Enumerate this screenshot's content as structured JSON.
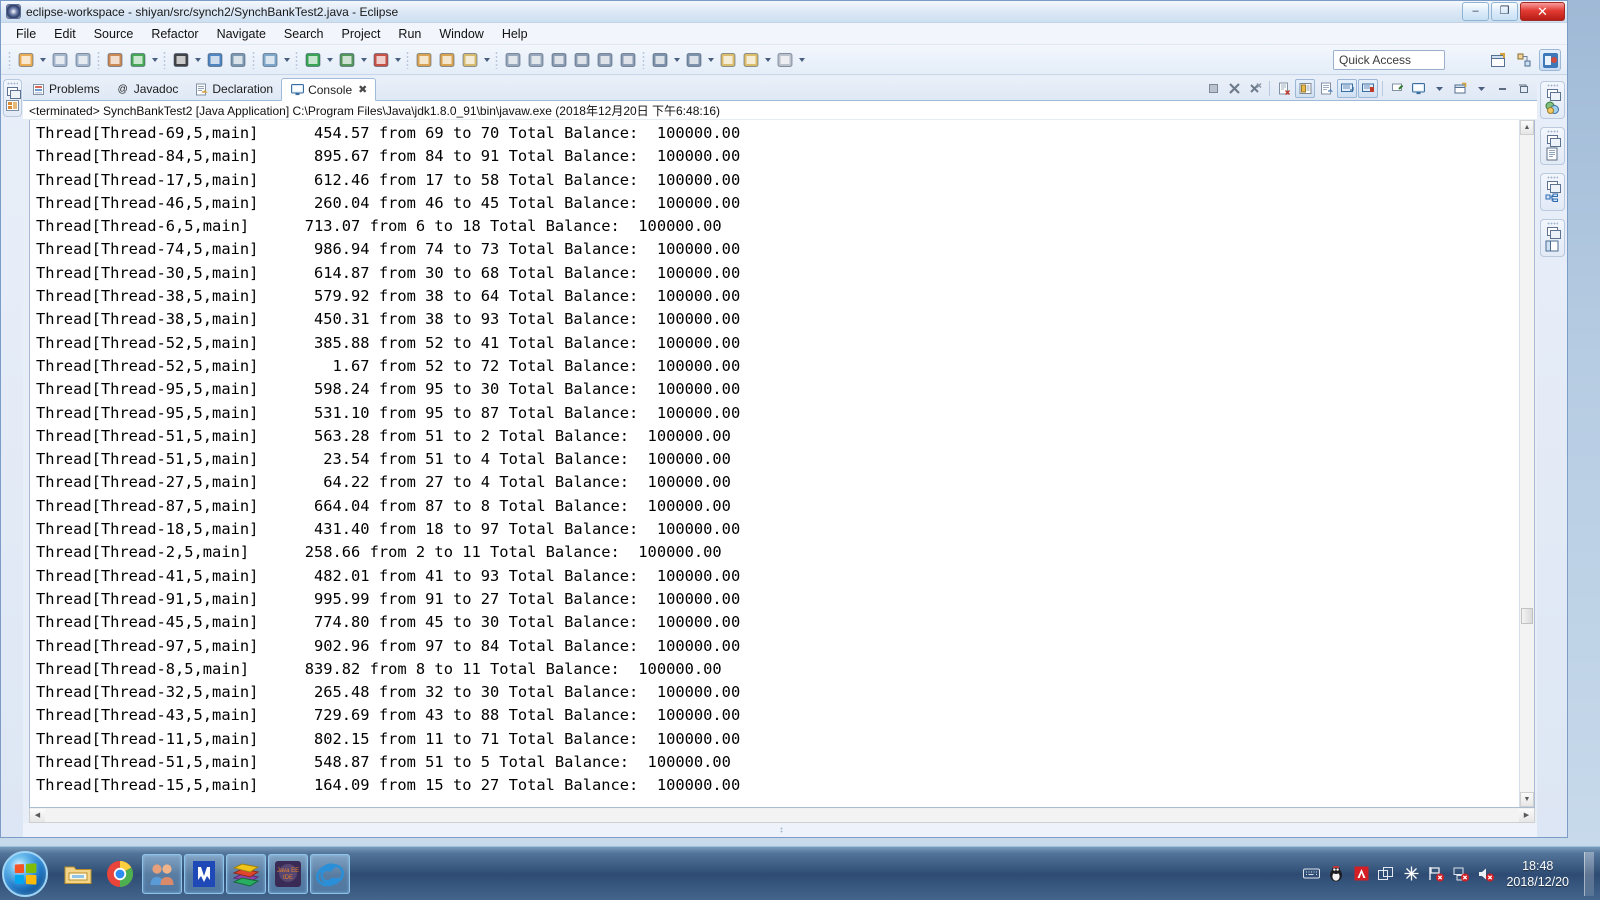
{
  "window": {
    "title": "eclipse-workspace - shiyan/src/synch2/SynchBankTest2.java - Eclipse",
    "app_icon": "eclipse-icon",
    "minimize_label": "–",
    "maximize_label": "❐",
    "close_label": "✕"
  },
  "menubar": {
    "items": [
      {
        "label": "File"
      },
      {
        "label": "Edit"
      },
      {
        "label": "Source"
      },
      {
        "label": "Refactor"
      },
      {
        "label": "Navigate"
      },
      {
        "label": "Search"
      },
      {
        "label": "Project"
      },
      {
        "label": "Run"
      },
      {
        "label": "Window"
      },
      {
        "label": "Help"
      }
    ]
  },
  "toolbar": {
    "quick_access_placeholder": "Quick Access",
    "quick_access_value": "",
    "items": [
      {
        "name": "new-wizard-icon",
        "glyph": "◰",
        "color": "#e8a33d",
        "arrow": true
      },
      {
        "name": "save-icon",
        "glyph": "▤",
        "color": "#9bb0c6",
        "arrow": false
      },
      {
        "name": "save-all-icon",
        "glyph": "▥",
        "color": "#9bb0c6",
        "arrow": false
      },
      {
        "name": "new-java-package-icon",
        "glyph": "⌗",
        "color": "#c77b3c",
        "arrow": false
      },
      {
        "name": "refresh-icon",
        "glyph": "⟳",
        "color": "#2f9e41",
        "arrow": true
      },
      {
        "name": "open-type-icon",
        "glyph": "●",
        "color": "#2b2b2b",
        "arrow": true
      },
      {
        "name": "open-console-icon",
        "glyph": "▣",
        "color": "#3a76b8",
        "arrow": false
      },
      {
        "name": "skip-breakpoints-icon",
        "glyph": "⊘",
        "color": "#6e8da8",
        "arrow": false
      },
      {
        "name": "debug-icon",
        "glyph": "✴",
        "color": "#6f9dc4",
        "arrow": true
      },
      {
        "name": "run-icon",
        "glyph": "▶",
        "color": "#1f9b3d",
        "arrow": true
      },
      {
        "name": "coverage-icon",
        "glyph": "◕",
        "color": "#3f8b46",
        "arrow": true
      },
      {
        "name": "run-external-tools-icon",
        "glyph": "◔",
        "color": "#c23b2e",
        "arrow": true
      },
      {
        "name": "new-java-project-icon",
        "glyph": "◱",
        "color": "#d79a3a",
        "arrow": false
      },
      {
        "name": "new-package-folder-icon",
        "glyph": "◲",
        "color": "#d79a3a",
        "arrow": false
      },
      {
        "name": "search-icon",
        "glyph": "✒",
        "color": "#d4b45c",
        "arrow": true
      },
      {
        "name": "next-annotation-icon",
        "glyph": "↑",
        "color": "#8d9eb4",
        "arrow": false
      },
      {
        "name": "previous-annotation-icon",
        "glyph": "↓",
        "color": "#8d9eb4",
        "arrow": false
      },
      {
        "name": "last-edit-location-icon",
        "glyph": "✎",
        "color": "#7e91a8",
        "arrow": false
      },
      {
        "name": "toggle-mark-occurrences-icon",
        "glyph": "☰",
        "color": "#7e91a8",
        "arrow": false
      },
      {
        "name": "show-whitespace-icon",
        "glyph": "▧",
        "color": "#7e91a8",
        "arrow": false
      },
      {
        "name": "paragraph-mark-icon",
        "glyph": "¶",
        "color": "#7e91a8",
        "arrow": false
      },
      {
        "name": "next-edit-position-icon",
        "glyph": "⤓",
        "color": "#6f86a0",
        "arrow": true
      },
      {
        "name": "previous-edit-position-icon",
        "glyph": "⤒",
        "color": "#6f86a0",
        "arrow": true
      },
      {
        "name": "back-history-icon",
        "glyph": "⇦",
        "color": "#d9b659",
        "arrow": false
      },
      {
        "name": "back-arrow-icon",
        "glyph": "⇦",
        "color": "#d9b659",
        "arrow": true
      },
      {
        "name": "forward-arrow-icon",
        "glyph": "⇨",
        "color": "#b6bcc6",
        "arrow": true
      }
    ],
    "perspective": [
      {
        "name": "open-perspective-icon",
        "glyph": "❐",
        "active": false
      },
      {
        "name": "perspective-java-ee-icon",
        "glyph": "⚙",
        "active": false
      },
      {
        "name": "perspective-java-icon",
        "glyph": "⌨",
        "active": true
      }
    ]
  },
  "left_rail": {
    "buttons": [
      {
        "name": "restore-package-explorer-button",
        "glyph": "▤",
        "color": "#c9792f"
      }
    ]
  },
  "right_rail": {
    "buttons": [
      {
        "name": "restore-outline-button",
        "glyph": "◐",
        "color": "#3e8b4a"
      },
      {
        "name": "restore-task-list-button",
        "glyph": "≡",
        "color": "#5b7fa8"
      },
      {
        "name": "restore-hierarchy-button",
        "glyph": "⊞",
        "color": "#2f6bb0"
      },
      {
        "name": "restore-minimap-button",
        "glyph": "▧",
        "color": "#5b7fa8"
      }
    ]
  },
  "view_tabs": [
    {
      "label": "Problems",
      "icon": "problems-icon",
      "glyph": "⚠",
      "active": false,
      "closable": false
    },
    {
      "label": "Javadoc",
      "icon": "javadoc-icon",
      "glyph": "@",
      "active": false,
      "closable": false
    },
    {
      "label": "Declaration",
      "icon": "declaration-icon",
      "glyph": "▤",
      "active": false,
      "closable": false
    },
    {
      "label": "Console",
      "icon": "console-icon",
      "glyph": "▣",
      "active": true,
      "closable": true,
      "close_glyph": "✖"
    }
  ],
  "view_toolbar": [
    {
      "name": "terminate-icon",
      "glyph": "■",
      "toggled": false
    },
    {
      "name": "remove-launch-icon",
      "glyph": "✖",
      "toggled": false
    },
    {
      "name": "remove-all-terminated-icon",
      "glyph": "✖",
      "toggled": false
    },
    {
      "name": "clear-console-icon",
      "glyph": "▤",
      "toggled": false
    },
    {
      "name": "scroll-lock-icon",
      "glyph": "▥",
      "toggled": true
    },
    {
      "name": "word-wrap-icon",
      "glyph": "▦",
      "toggled": false
    },
    {
      "name": "show-console-on-output-icon",
      "glyph": "▣",
      "toggled": true
    },
    {
      "name": "show-console-on-error-icon",
      "glyph": "▣",
      "toggled": true
    },
    {
      "name": "pin-console-icon",
      "glyph": "⚑",
      "toggled": false
    },
    {
      "name": "display-selected-console-icon",
      "glyph": "▣",
      "toggled": false,
      "arrow": true
    },
    {
      "name": "open-console-icon",
      "glyph": "◰",
      "toggled": false,
      "arrow": true
    },
    {
      "name": "minimize-view-icon",
      "glyph": "—",
      "toggled": false
    },
    {
      "name": "maximize-view-icon",
      "glyph": "❐",
      "toggled": false
    }
  ],
  "console": {
    "launch_line": "<terminated> SynchBankTest2 [Java Application] C:\\Program Files\\Java\\jdk1.8.0_91\\bin\\javaw.exe (2018年12月20日 下午6:48:16)",
    "lines": [
      "Thread[Thread-69,5,main]      454.57 from 69 to 70 Total Balance:  100000.00",
      "Thread[Thread-84,5,main]      895.67 from 84 to 91 Total Balance:  100000.00",
      "Thread[Thread-17,5,main]      612.46 from 17 to 58 Total Balance:  100000.00",
      "Thread[Thread-46,5,main]      260.04 from 46 to 45 Total Balance:  100000.00",
      "Thread[Thread-6,5,main]      713.07 from 6 to 18 Total Balance:  100000.00",
      "Thread[Thread-74,5,main]      986.94 from 74 to 73 Total Balance:  100000.00",
      "Thread[Thread-30,5,main]      614.87 from 30 to 68 Total Balance:  100000.00",
      "Thread[Thread-38,5,main]      579.92 from 38 to 64 Total Balance:  100000.00",
      "Thread[Thread-38,5,main]      450.31 from 38 to 93 Total Balance:  100000.00",
      "Thread[Thread-52,5,main]      385.88 from 52 to 41 Total Balance:  100000.00",
      "Thread[Thread-52,5,main]        1.67 from 52 to 72 Total Balance:  100000.00",
      "Thread[Thread-95,5,main]      598.24 from 95 to 30 Total Balance:  100000.00",
      "Thread[Thread-95,5,main]      531.10 from 95 to 87 Total Balance:  100000.00",
      "Thread[Thread-51,5,main]      563.28 from 51 to 2 Total Balance:  100000.00",
      "Thread[Thread-51,5,main]       23.54 from 51 to 4 Total Balance:  100000.00",
      "Thread[Thread-27,5,main]       64.22 from 27 to 4 Total Balance:  100000.00",
      "Thread[Thread-87,5,main]      664.04 from 87 to 8 Total Balance:  100000.00",
      "Thread[Thread-18,5,main]      431.40 from 18 to 97 Total Balance:  100000.00",
      "Thread[Thread-2,5,main]      258.66 from 2 to 11 Total Balance:  100000.00",
      "Thread[Thread-41,5,main]      482.01 from 41 to 93 Total Balance:  100000.00",
      "Thread[Thread-91,5,main]      995.99 from 91 to 27 Total Balance:  100000.00",
      "Thread[Thread-45,5,main]      774.80 from 45 to 30 Total Balance:  100000.00",
      "Thread[Thread-97,5,main]      902.96 from 97 to 84 Total Balance:  100000.00",
      "Thread[Thread-8,5,main]      839.82 from 8 to 11 Total Balance:  100000.00",
      "Thread[Thread-32,5,main]      265.48 from 32 to 30 Total Balance:  100000.00",
      "Thread[Thread-43,5,main]      729.69 from 43 to 88 Total Balance:  100000.00",
      "Thread[Thread-11,5,main]      802.15 from 11 to 71 Total Balance:  100000.00",
      "Thread[Thread-51,5,main]      548.87 from 51 to 5 Total Balance:  100000.00",
      "Thread[Thread-15,5,main]      164.09 from 15 to 27 Total Balance:  100000.00"
    ],
    "scroll_up_glyph": "▲",
    "scroll_down_glyph": "▼",
    "scroll_left_glyph": "◀",
    "scroll_right_glyph": "▶"
  },
  "taskbar": {
    "start_label": "start-orb",
    "apps": [
      {
        "name": "taskbar-file-explorer",
        "glyph": "Ὄ1",
        "kind": "pinned",
        "colors": [
          "#f0c86a",
          "#e8b74a"
        ]
      },
      {
        "name": "taskbar-google-chrome",
        "glyph": "chrome",
        "kind": "pinned",
        "colors": [
          "#2d8cf0",
          "#e9453a"
        ]
      },
      {
        "name": "taskbar-qq",
        "glyph": "people",
        "kind": "running",
        "colors": [
          "#d98a6a",
          "#5a9ad6"
        ]
      },
      {
        "name": "taskbar-wps-writer",
        "glyph": "W",
        "kind": "running",
        "colors": [
          "#1f49b6",
          "#ffffff"
        ]
      },
      {
        "name": "taskbar-winrar",
        "glyph": "books",
        "kind": "running",
        "colors": [
          "#7a3f8c",
          "#e0452e"
        ]
      },
      {
        "name": "taskbar-eclipse-java-ee-ide",
        "glyph": "Java EE IDE",
        "kind": "running",
        "colors": [
          "#3a2a56",
          "#e6832a"
        ]
      },
      {
        "name": "taskbar-internet-explorer",
        "glyph": "e",
        "kind": "running",
        "colors": [
          "#2a8fd6",
          "#d9e9f7"
        ]
      }
    ],
    "tray": [
      {
        "name": "tray-keyboard-icon",
        "glyph": "⌨",
        "color": "#d8dde6"
      },
      {
        "name": "tray-qq-penguin-icon",
        "glyph": "●",
        "color": "#2a2a2a"
      },
      {
        "name": "tray-adobe-icon",
        "glyph": "A",
        "color": "#d21f26"
      },
      {
        "name": "tray-window-switch-icon",
        "glyph": "⧉",
        "color": "#e4e9f1"
      },
      {
        "name": "tray-sunburst-icon",
        "glyph": "✸",
        "color": "#ffffff"
      },
      {
        "name": "tray-flag-action-center-icon",
        "glyph": "⚑",
        "color": "#eceff4"
      },
      {
        "name": "tray-network-error-icon",
        "glyph": "▣",
        "color": "#dfe5ee"
      },
      {
        "name": "tray-volume-muted-icon",
        "glyph": "♫",
        "color": "#eceff4"
      }
    ],
    "clock_time": "18:48",
    "clock_date": "2018/12/20"
  }
}
